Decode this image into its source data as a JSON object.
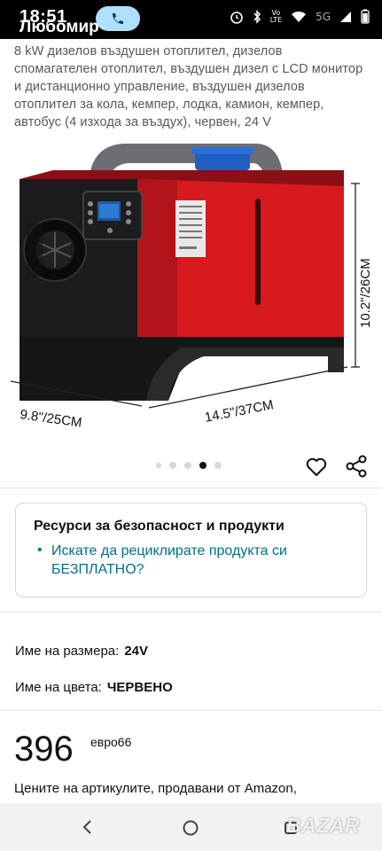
{
  "status_bar": {
    "time": "18:51",
    "name_overlay": "Любомир",
    "icons": [
      "alarm-icon",
      "bluetooth-icon",
      "volte-icon",
      "wifi-icon",
      "5g-signal-icon",
      "signal-icon",
      "battery-icon"
    ],
    "lte_label_1": "Vo",
    "lte_label_2": "LTE",
    "fiveg_label": "5G"
  },
  "product": {
    "title": "8 kW дизелов въздушен отоплител, дизелов спомагателен отоплител, въздушен дизел с LCD монитор и дистанционно управление, въздушен дизелов отоплител за кола, кемпер, лодка, камион, кемпер, автобус (4 изхода за въздух), червен, 24 V",
    "image": {
      "dim_width": "9.8\"/25CM",
      "dim_length": "14.5\"/37CM",
      "dim_height": "10.2\"/26CM",
      "body_color": "#d71920",
      "cap_color": "#1f5fc4"
    },
    "carousel": {
      "count": 5,
      "active_index": 3
    }
  },
  "resources_card": {
    "title": "Ресурси за безопасност и продукти",
    "link": "Искате да рециклирате продукта си БЕЗПЛАТНО?"
  },
  "variations": {
    "size_label": "Име на размера:",
    "size_value": "24V",
    "color_label": "Име на цвета:",
    "color_value": "ЧЕРВЕНО"
  },
  "price": {
    "amount": "396",
    "suffix": "евро66"
  },
  "note": "Цените на артикулите, продавани от Amazon,",
  "watermark": "BAZAR",
  "colors": {
    "link": "#007185",
    "text": "#0f1111",
    "muted": "#565959"
  }
}
